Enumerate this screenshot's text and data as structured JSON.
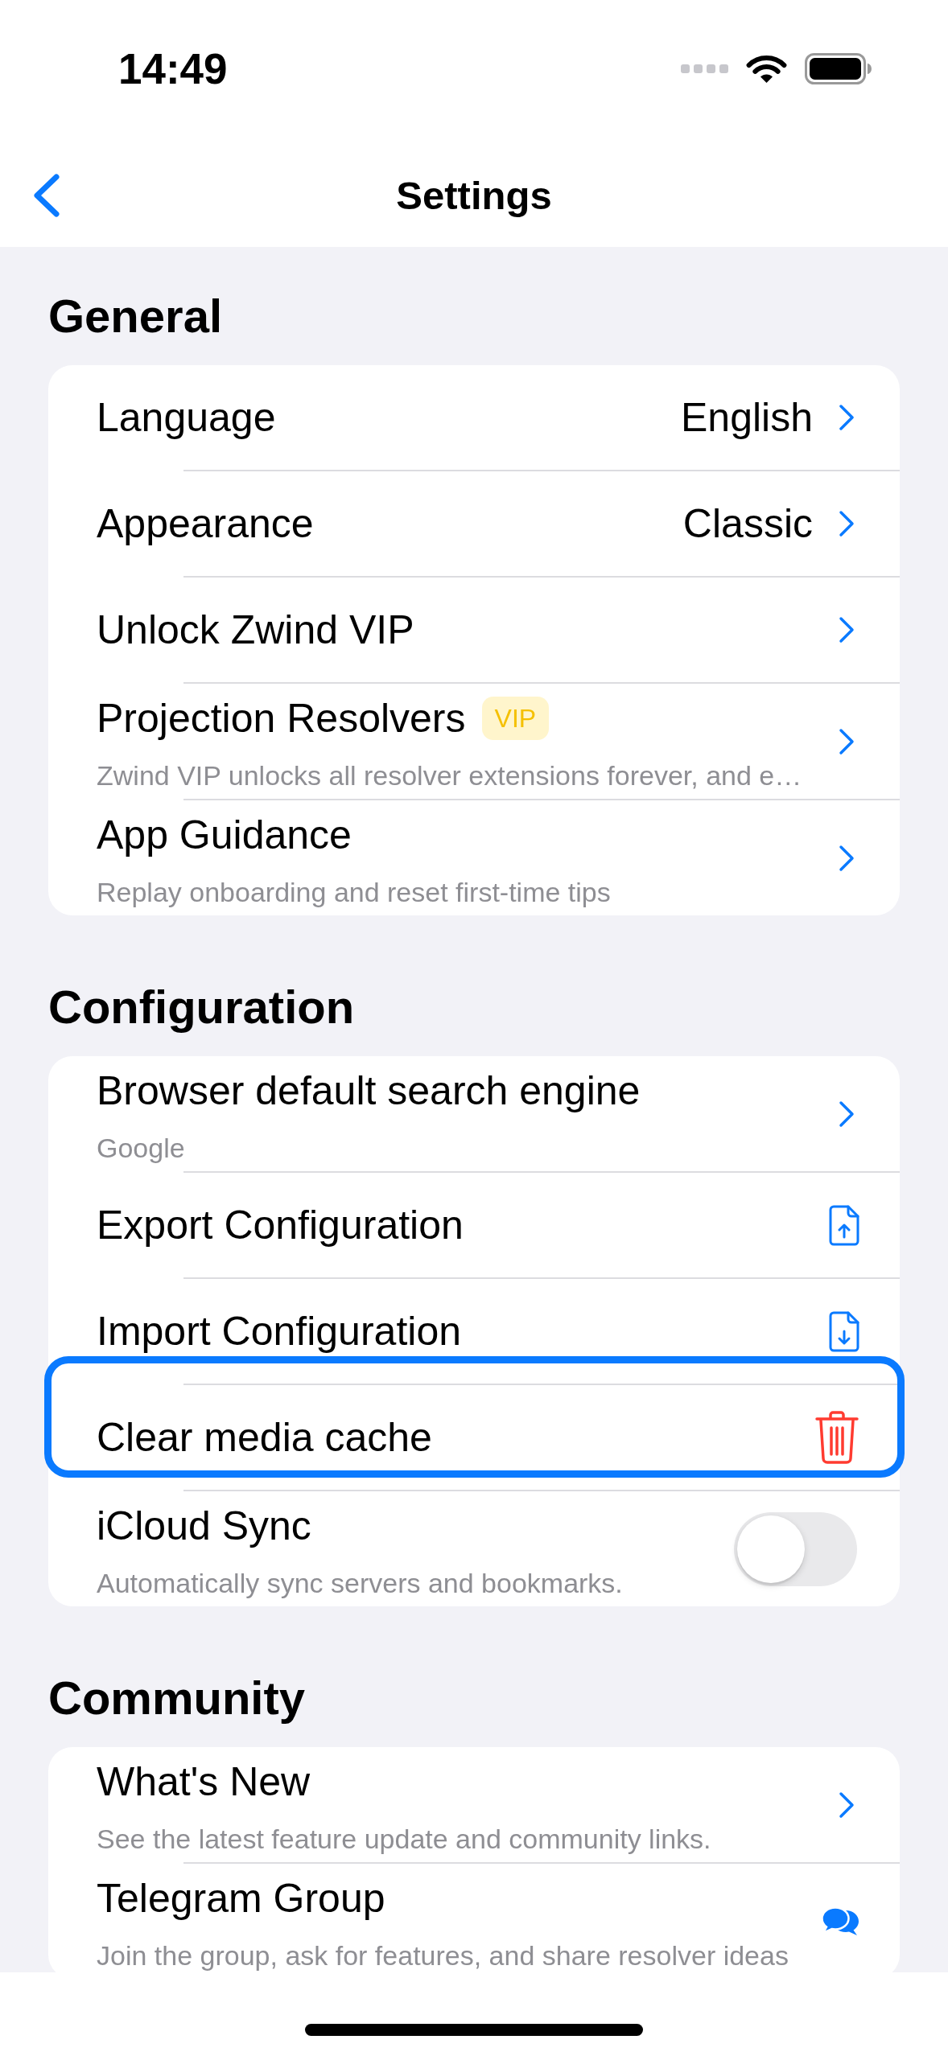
{
  "status_bar": {
    "time": "14:49"
  },
  "nav_bar": {
    "title": "Settings"
  },
  "sections": [
    {
      "title": "General",
      "items": [
        {
          "kind": "link",
          "title": "Language",
          "value": "English",
          "highlighted": false
        },
        {
          "kind": "link",
          "title": "Appearance",
          "value": "Classic",
          "highlighted": false
        },
        {
          "kind": "link",
          "title": "Unlock Zwind VIP",
          "highlighted": false
        },
        {
          "kind": "link",
          "title": "Projection Resolvers",
          "badge": "VIP",
          "subtitle": "Zwind VIP unlocks all resolver extensions forever, and e…",
          "highlighted": false
        },
        {
          "kind": "link",
          "title": "App Guidance",
          "subtitle": "Replay onboarding and reset first-time tips",
          "highlighted": false
        }
      ]
    },
    {
      "title": "Configuration",
      "items": [
        {
          "kind": "link",
          "title": "Browser default search engine",
          "subtitle": "Google",
          "highlighted": false
        },
        {
          "kind": "export",
          "title": "Export Configuration",
          "highlighted": false
        },
        {
          "kind": "import",
          "title": "Import Configuration",
          "highlighted": false
        },
        {
          "kind": "delete",
          "title": "Clear media cache",
          "highlighted": true
        },
        {
          "kind": "toggle",
          "title": "iCloud Sync",
          "subtitle": "Automatically sync servers and bookmarks.",
          "on": false,
          "highlighted": false
        }
      ]
    },
    {
      "title": "Community",
      "items": [
        {
          "kind": "link",
          "title": "What's New",
          "subtitle": "See the latest feature update and community links.",
          "highlighted": false
        },
        {
          "kind": "chat",
          "title": "Telegram Group",
          "subtitle": "Join the group, ask for features, and share resolver ideas",
          "highlighted": false
        }
      ]
    }
  ]
}
